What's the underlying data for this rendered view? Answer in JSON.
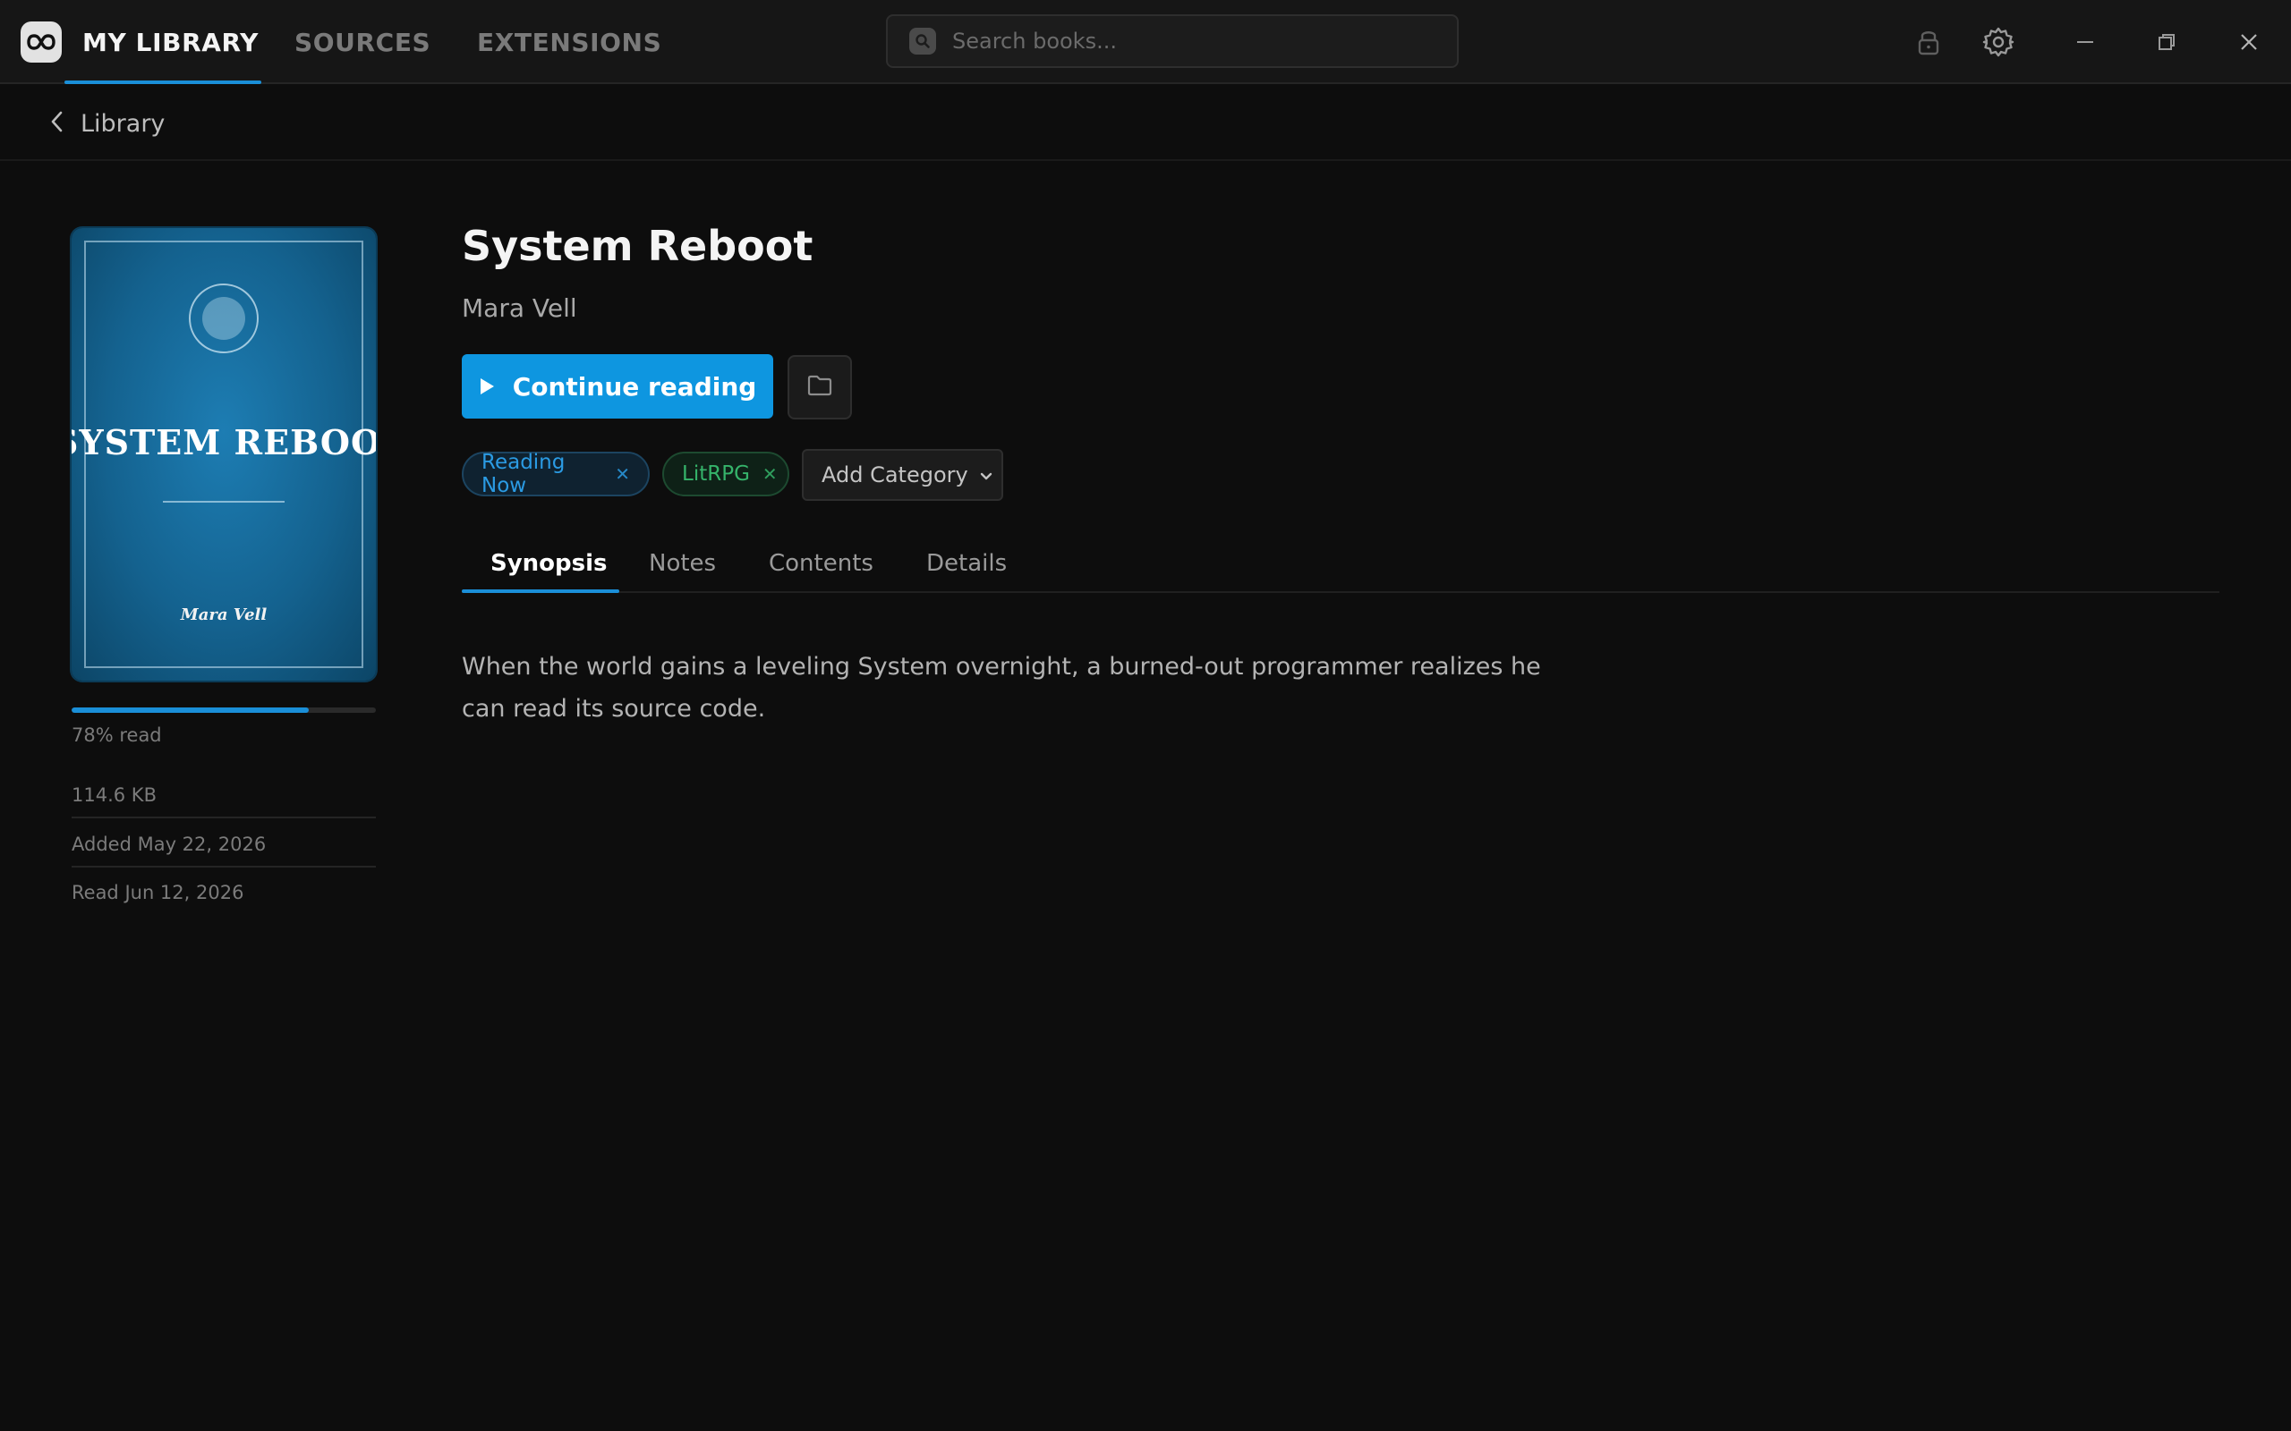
{
  "topbar": {
    "tabs": [
      {
        "label": "MY LIBRARY",
        "active": true
      },
      {
        "label": "SOURCES",
        "active": false
      },
      {
        "label": "EXTENSIONS",
        "active": false
      }
    ],
    "search_placeholder": "Search books...",
    "icons": [
      "lock-icon",
      "gear-icon",
      "minimize-icon",
      "maximize-icon",
      "close-icon"
    ]
  },
  "breadcrumb": {
    "label": "Library"
  },
  "book": {
    "cover_title": "SYSTEM REBOOT",
    "cover_author": "Mara Vell",
    "title": "System Reboot",
    "author": "Mara Vell",
    "progress": 0.78,
    "progress_label": "78% read",
    "size": "114.6 KB",
    "added": "Added May 22, 2026",
    "read": "Read Jun 12, 2026"
  },
  "actions": {
    "continue_label": "Continue reading",
    "categories": [
      {
        "label": "Reading Now",
        "color": "#2b9be3"
      },
      {
        "label": "LitRPG",
        "color": "#35b36a"
      }
    ],
    "add_category_label": "Add Category"
  },
  "detail_tabs": [
    {
      "label": "Synopsis",
      "active": true
    },
    {
      "label": "Notes",
      "active": false
    },
    {
      "label": "Contents",
      "active": false
    },
    {
      "label": "Details",
      "active": false
    }
  ],
  "synopsis": "When the world gains a leveling System overnight, a burned-out programmer realizes he can read its source code.",
  "colors": {
    "accent": "#1a8fd8",
    "button": "#0e96e0",
    "background": "#0d0d0d"
  }
}
